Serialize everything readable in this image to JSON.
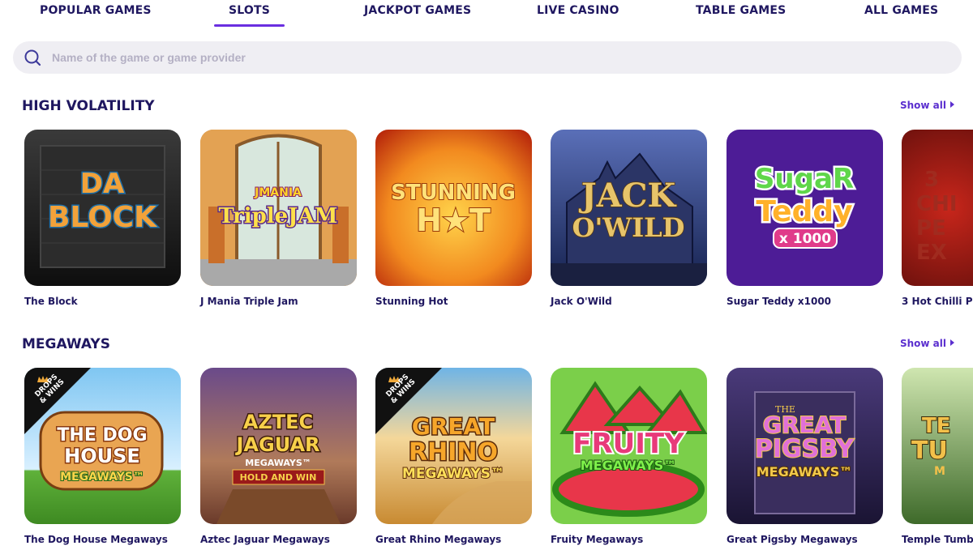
{
  "tabs": [
    {
      "label": "POPULAR GAMES",
      "active": false
    },
    {
      "label": "SLOTS",
      "active": true
    },
    {
      "label": "JACKPOT GAMES",
      "active": false
    },
    {
      "label": "LIVE CASINO",
      "active": false
    },
    {
      "label": "TABLE GAMES",
      "active": false
    },
    {
      "label": "ALL GAMES",
      "active": false
    }
  ],
  "search": {
    "placeholder": "Name of the game or game provider",
    "value": ""
  },
  "colors": {
    "accent": "#6a2ee0",
    "text": "#1f1760",
    "search_bg": "#efeef3"
  },
  "sections": [
    {
      "title": "HIGH VOLATILITY",
      "show_all": "Show all",
      "games": [
        {
          "name": "The Block",
          "art": "DA BLOCK"
        },
        {
          "name": "J Mania Triple Jam",
          "art": "JMANIA Triple JAM"
        },
        {
          "name": "Stunning Hot",
          "art": "STUNNING HOT"
        },
        {
          "name": "Jack O'Wild",
          "art": "JACK O'WILD"
        },
        {
          "name": "Sugar Teddy x1000",
          "art": "Sugar Teddy x1000"
        },
        {
          "name": "3 Hot Chilli P",
          "art": "3 CHI PE EX"
        }
      ]
    },
    {
      "title": "MEGAWAYS",
      "show_all": "Show all",
      "games": [
        {
          "name": "The Dog House Megaways",
          "art": "THE DOG HOUSE MEGAWAYS",
          "badge": "DROPS & WINS"
        },
        {
          "name": "Aztec Jaguar Megaways",
          "art": "AZTEC JAGUAR MEGAWAYS HOLD AND WIN"
        },
        {
          "name": "Great Rhino Megaways",
          "art": "GREAT RHINO MEGAWAYS",
          "badge": "DROPS & WINS"
        },
        {
          "name": "Fruity Megaways",
          "art": "FRUITY MEGAWAYS"
        },
        {
          "name": "Great Pigsby Megaways",
          "art": "THE GREAT PIGSBY MEGAWAYS"
        },
        {
          "name": "Temple Tumb",
          "art": "TE TU M"
        }
      ]
    }
  ]
}
